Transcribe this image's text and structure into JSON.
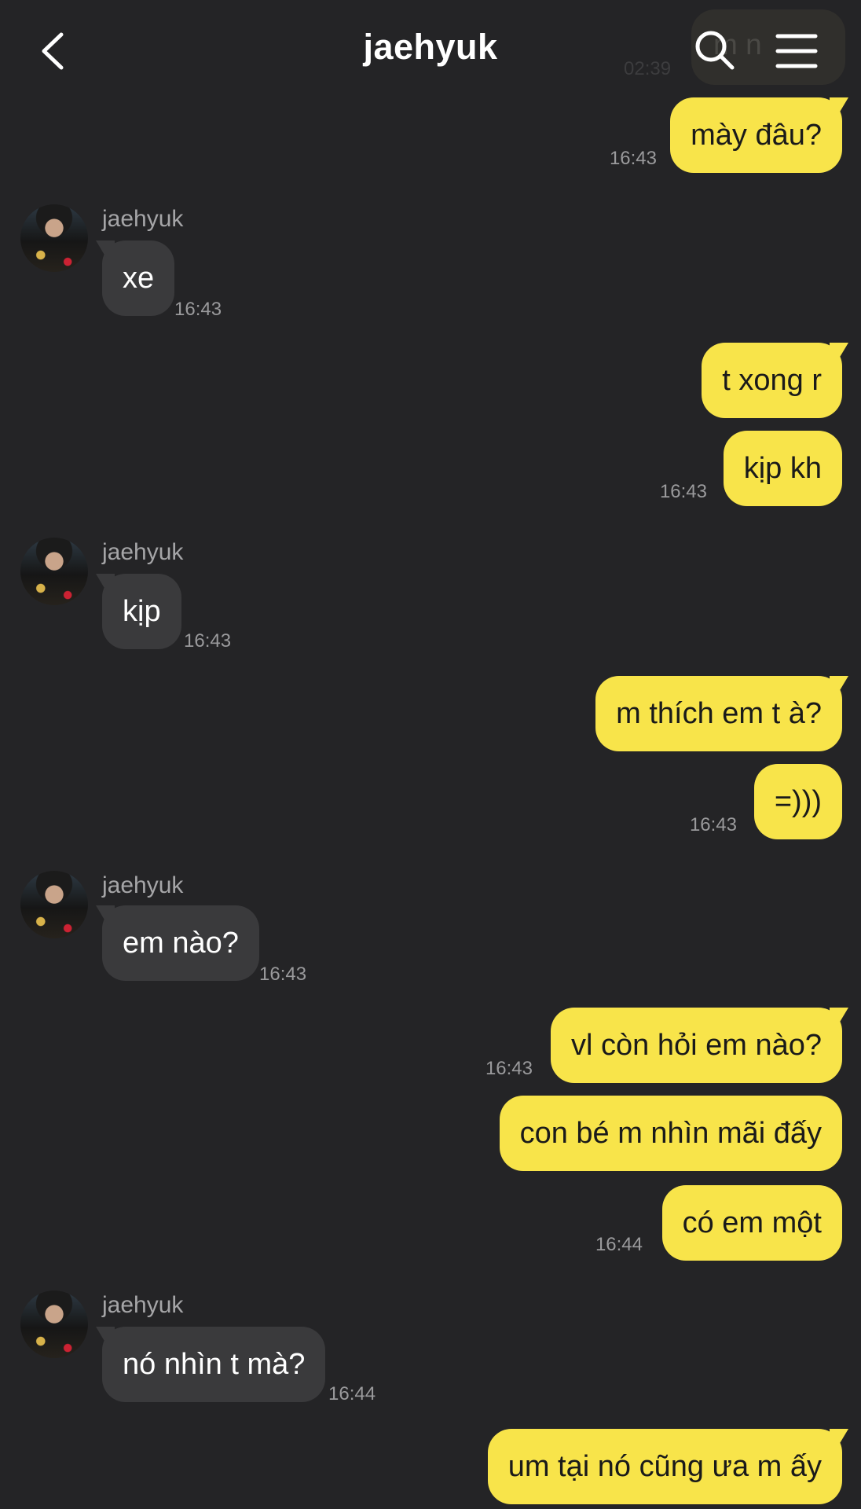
{
  "header": {
    "title": "jaehyuk",
    "back_icon": "chevron-left-icon",
    "search_icon": "search-icon",
    "menu_icon": "hamburger-menu-icon"
  },
  "ghost": {
    "text": "m n",
    "time": "02:39"
  },
  "contact": {
    "name": "jaehyuk"
  },
  "colors": {
    "background": "#242426",
    "my_bubble": "#f8e44a",
    "their_bubble": "#3a3a3c",
    "timestamp": "#9a9a9c"
  },
  "messages": [
    {
      "from": "me",
      "text": "mày đâu?",
      "time": "16:43"
    },
    {
      "from": "them",
      "sender": "jaehyuk",
      "text": "xe",
      "time": "16:43"
    },
    {
      "from": "me",
      "text": "t xong r",
      "time": ""
    },
    {
      "from": "me",
      "text": "kịp kh",
      "time": "16:43"
    },
    {
      "from": "them",
      "sender": "jaehyuk",
      "text": "kịp",
      "time": "16:43"
    },
    {
      "from": "me",
      "text": "m thích em t à?",
      "time": ""
    },
    {
      "from": "me",
      "text": "=)))",
      "time": "16:43"
    },
    {
      "from": "them",
      "sender": "jaehyuk",
      "text": "em nào?",
      "time": "16:43"
    },
    {
      "from": "me",
      "text": "vl còn hỏi em nào?",
      "time": "16:43"
    },
    {
      "from": "me",
      "text": "con bé m nhìn mãi đấy",
      "time": ""
    },
    {
      "from": "me",
      "text": "có em một",
      "time": "16:44"
    },
    {
      "from": "them",
      "sender": "jaehyuk",
      "text": "nó nhìn t mà?",
      "time": "16:44"
    },
    {
      "from": "me",
      "text": "um tại nó cũng ưa m ấy",
      "time": ""
    }
  ]
}
